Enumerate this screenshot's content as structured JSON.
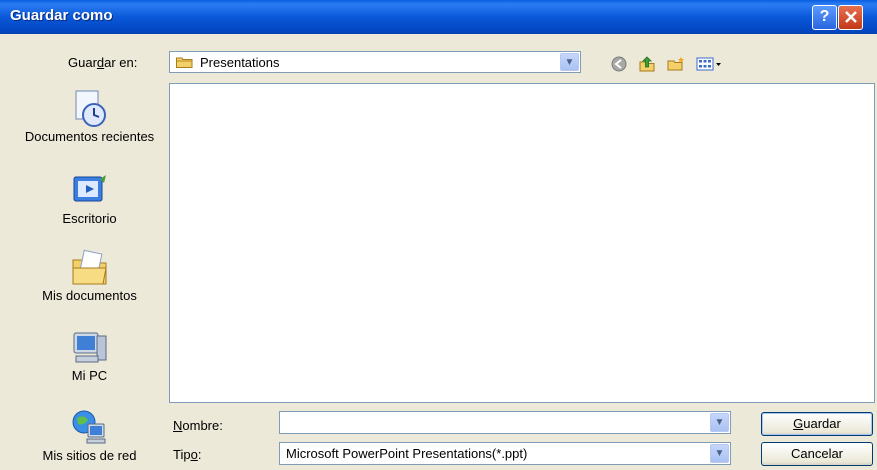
{
  "dialog": {
    "title": "Guardar como",
    "help_label": "?",
    "close_label": "✕"
  },
  "save_in": {
    "label": "Guardar en:",
    "value": "Presentations",
    "icon": "folder-icon"
  },
  "toolbar": {
    "icons": [
      "back-icon",
      "up-folder-icon",
      "new-folder-icon",
      "views-menu-icon"
    ]
  },
  "places": [
    {
      "label": "Documentos recientes",
      "icon": "recent-documents-icon"
    },
    {
      "label": "Escritorio",
      "icon": "desktop-icon"
    },
    {
      "label": "Mis documentos",
      "icon": "my-documents-icon"
    },
    {
      "label": "Mi PC",
      "icon": "my-computer-icon"
    },
    {
      "label": "Mis sitios de red",
      "icon": "network-places-icon"
    }
  ],
  "file_name": {
    "label": "Nombre:",
    "value": ""
  },
  "file_type": {
    "label": "Tipo:",
    "value": "Microsoft PowerPoint Presentations(*.ppt)"
  },
  "buttons": {
    "save": "Guardar",
    "cancel": "Cancelar"
  },
  "colors": {
    "titlebar": "#0a58d8",
    "dialog_bg": "#ece9d8",
    "field_border": "#7f9db9"
  }
}
